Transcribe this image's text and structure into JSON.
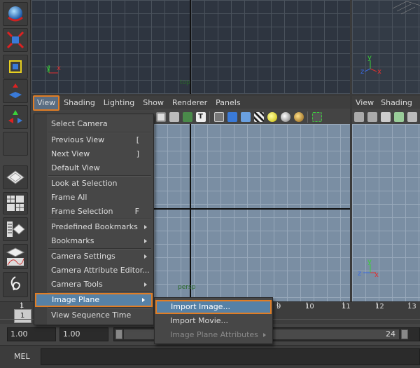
{
  "viewport_top": {
    "camera_label": "top"
  },
  "viewport_main_bottom_label": "persp",
  "panel_main": {
    "menus": [
      "View",
      "Shading",
      "Lighting",
      "Show",
      "Renderer",
      "Panels"
    ]
  },
  "panel_right": {
    "menus": [
      "View",
      "Shading"
    ]
  },
  "axis_labels": {
    "x": "x",
    "y": "y",
    "z": "z"
  },
  "view_menu": {
    "items": [
      {
        "label": "Select Camera",
        "shortcut": "",
        "submenu": false
      },
      {
        "label": "Previous View",
        "shortcut": "[",
        "submenu": false
      },
      {
        "label": "Next View",
        "shortcut": "]",
        "submenu": false
      },
      {
        "label": "Default View",
        "shortcut": "",
        "submenu": false
      },
      {
        "label": "Look at Selection",
        "shortcut": "",
        "submenu": false
      },
      {
        "label": "Frame All",
        "shortcut": "",
        "submenu": false
      },
      {
        "label": "Frame Selection",
        "shortcut": "F",
        "submenu": false
      },
      {
        "label": "Predefined Bookmarks",
        "shortcut": "",
        "submenu": true
      },
      {
        "label": "Bookmarks",
        "shortcut": "",
        "submenu": true
      },
      {
        "label": "Camera Settings",
        "shortcut": "",
        "submenu": true
      },
      {
        "label": "Camera Attribute Editor...",
        "shortcut": "",
        "submenu": false
      },
      {
        "label": "Camera Tools",
        "shortcut": "",
        "submenu": true
      },
      {
        "label": "Image Plane",
        "shortcut": "",
        "submenu": true
      },
      {
        "label": "View Sequence Time",
        "shortcut": "",
        "submenu": false
      }
    ]
  },
  "image_plane_submenu": {
    "items": [
      {
        "label": "Import Image...",
        "enabled": true
      },
      {
        "label": "Import Movie...",
        "enabled": true
      },
      {
        "label": "Image Plane Attributes",
        "enabled": false
      }
    ]
  },
  "time_slider": {
    "left_numbers": [
      "1",
      "1"
    ],
    "right_numbers": [
      "9",
      "10",
      "11",
      "12",
      "13"
    ]
  },
  "range_slider": {
    "start_time": "1.00",
    "playback_start": "1.00",
    "range_start": "1",
    "range_end": "24"
  },
  "command_line": {
    "language": "MEL"
  },
  "colors": {
    "highlight_border": "#e07d25",
    "highlight_fill": "#5681a6",
    "axis_x": "#e03030",
    "axis_y": "#3ad03a",
    "axis_z": "#3a6ae0"
  }
}
